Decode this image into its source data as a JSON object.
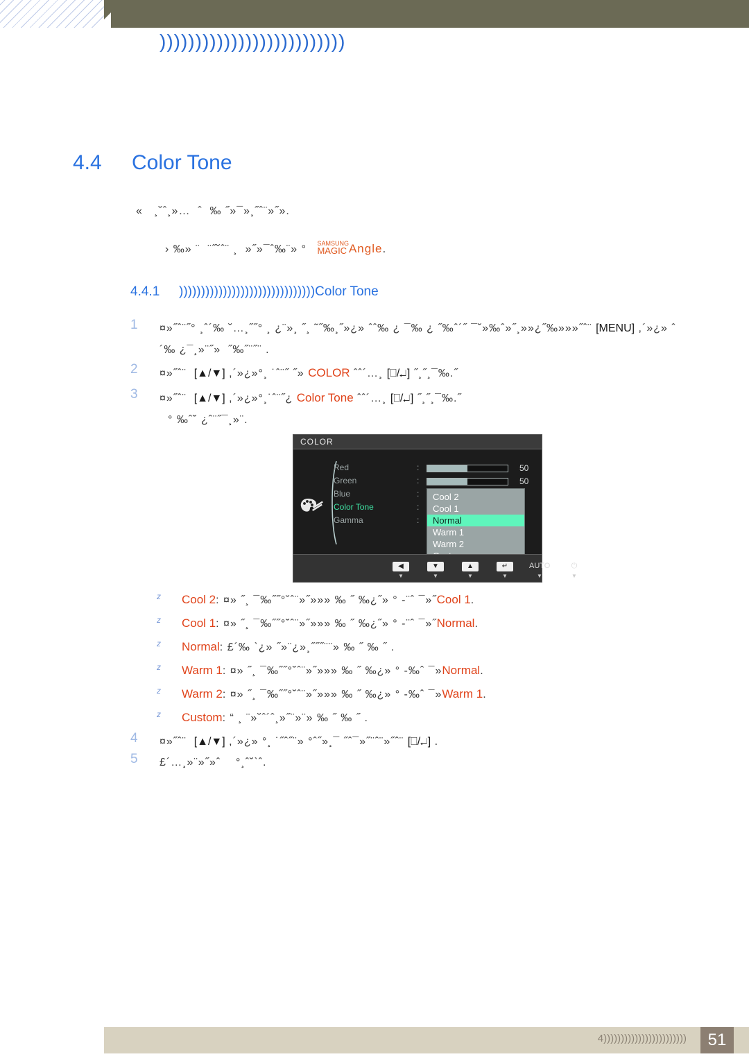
{
  "header": {
    "chapter_title": "))))))))))))))))))))))))))"
  },
  "section": {
    "number": "4.4",
    "title": "Color Tone"
  },
  "intro": {
    "line1": "«   ¸˘ˆ¸»…  ˆ  ‰ ˝»¯»¸˝ˆ¨»˝».",
    "line2": "› ‰» ¨  ¨˝˘ˆ¨ ¸  »˝»¯ˆ‰¨» °",
    "magic_top": "SAMSUNG",
    "magic_bottom": "MAGIC",
    "magic_word": "Angle",
    "magic_dot": "."
  },
  "subsection": {
    "number": "4.4.1",
    "boxes": ")))))))))))))))))))))))))))))))",
    "title": "Color Tone"
  },
  "steps": [
    {
      "number": "1",
      "segments": [
        {
          "type": "text",
          "value": "¤»˝ˆ¨˝° ¸ˆ´‰ ˘…¸˝˝° ¸ ¿¨»¸ ˝¸ ˜˝‰¸˝»¿» ˆˆ‰ ¿ ¯‰ ¿ ˝‰ˆ´˝"
        },
        {
          "type": "text",
          "value": "¯˘»‰ˆ»˝¸»»¿˝‰»»»˝ˆ¨"
        },
        {
          "type": "key",
          "value": "[MENU]"
        },
        {
          "type": "text",
          "value": ",´»¿» ˆ´‰ ¿¯¸»¨˝»  ˝‰˝¨˝¨ ."
        }
      ]
    },
    {
      "number": "2",
      "segments": [
        {
          "type": "text",
          "value": "¤»˝ˆ¨ "
        },
        {
          "type": "key",
          "value": "[▲/▼]"
        },
        {
          "type": "text",
          "value": ",´»¿»°¸ ˙ˆ¨˝ ˝»"
        },
        {
          "type": "kw",
          "value": "COLOR"
        },
        {
          "type": "text",
          "value": "ˆˆ´…¸"
        },
        {
          "type": "key",
          "value": "[⎕/↵]"
        },
        {
          "type": "text",
          "value": "˝¸˝¸¯‰.˝"
        }
      ]
    },
    {
      "number": "3",
      "segments": [
        {
          "type": "text",
          "value": "¤»˝ˆ¨ "
        },
        {
          "type": "key",
          "value": "[▲/▼]"
        },
        {
          "type": "text",
          "value": ",´»¿»°¸˙ˆ¨˝¿"
        },
        {
          "type": "kw",
          "value": "Color Tone"
        },
        {
          "type": "text",
          "value": "ˆˆ´…¸"
        },
        {
          "type": "key",
          "value": "[⎕/↵]"
        },
        {
          "type": "text",
          "value": "˝¸˝¸¯‰.˝"
        }
      ],
      "line2": "° ‰ˆ˘ ¿ˆ¨˝¯¸»¨."
    }
  ],
  "osd": {
    "title": "COLOR",
    "icon": "palette-icon",
    "rows": [
      {
        "label": "Red",
        "colon": ":",
        "kind": "slider",
        "value": "50",
        "percent": 50
      },
      {
        "label": "Green",
        "colon": ":",
        "kind": "slider",
        "value": "50",
        "percent": 50
      },
      {
        "label": "Blue",
        "colon": ":",
        "kind": "none"
      },
      {
        "label": "Color Tone",
        "colon": ":",
        "kind": "none",
        "active": true
      },
      {
        "label": "Gamma",
        "colon": ":",
        "kind": "none"
      }
    ],
    "dropdown": {
      "items": [
        "Cool 2",
        "Cool 1",
        "Normal",
        "Warm 1",
        "Warm 2",
        "Custom"
      ],
      "selected": "Normal"
    },
    "footer_keys": [
      {
        "name": "left-arrow-key",
        "glyph": "◀",
        "style": "box",
        "mark": "▼"
      },
      {
        "name": "down-arrow-key",
        "glyph": "▼",
        "style": "box",
        "mark": "▼"
      },
      {
        "name": "up-arrow-key",
        "glyph": "▲",
        "style": "box",
        "mark": "▼"
      },
      {
        "name": "enter-key",
        "glyph": "↵",
        "style": "box",
        "mark": "▼"
      },
      {
        "name": "auto-key",
        "glyph": "AUTO",
        "style": "text",
        "mark": "▼"
      },
      {
        "name": "power-key",
        "glyph": "⏻",
        "style": "text",
        "mark": "▼"
      }
    ],
    "colors": {
      "background": "#1c1c1c",
      "titlebar": "#3b3b3b",
      "active_label": "#3fe3a4",
      "dropdown_bg": "#9aa5a5",
      "selected_bg": "#5ff5bc",
      "slider_fill": "#a6bbbb"
    }
  },
  "bullets": [
    {
      "marker": "z",
      "label": "Cool 2",
      "colon": ":",
      "text": "¤» ˝¸ ¯‰˝˝°˘ˆ¨»˝»»» ‰ ˝ ‰¿˝» ° -¨ˆ ¯»˝",
      "ref": "Cool 1",
      "period": "."
    },
    {
      "marker": "z",
      "label": "Cool 1",
      "colon": ":",
      "text": "¤» ˝¸ ¯‰˝˝°˘ˆ¨»˝»»» ‰ ˝ ‰¿˝» ° -¨ˆ ¯»˝",
      "ref": "Normal",
      "period": "."
    },
    {
      "marker": "z",
      "label": "Normal",
      "colon": ":",
      "text": "£´‰ ˋ¿» ˝»¨¿»¸˝˝˝¨¨» ‰ ˝ ‰ ˝ .",
      "ref": "",
      "period": ""
    },
    {
      "marker": "z",
      "label": "Warm 1",
      "colon": ":",
      "text": "¤» ˝¸ ¯‰˝˝°˘ˆ¨»˝»»» ‰ ˝ ‰¿» ° -‰ˆ ¯»",
      "ref": "Normal",
      "period": "."
    },
    {
      "marker": "z",
      "label": "Warm 2",
      "colon": ":",
      "text": "¤» ˝¸ ¯‰˝˝°˘ˆ¨»˝»»» ‰ ˝ ‰¿» ° -‰ˆ ¯»",
      "ref": "Warm 1",
      "period": "."
    },
    {
      "marker": "z",
      "label": "Custom",
      "colon": ":",
      "text": "“ ¸ ¨»˘ˆ´ˆ¸»˝¨»¨» ‰ ˝ ‰ ˝ .",
      "ref": "",
      "period": ""
    }
  ],
  "steps_tail": [
    {
      "number": "4",
      "segments": [
        {
          "type": "text",
          "value": "¤»˝ˆ¨ "
        },
        {
          "type": "key",
          "value": "[▲/▼]"
        },
        {
          "type": "text",
          "value": ",´»¿» °¸ ˙˝ˆ˝¨» °ˆ˝»¸¯ ˝ˆ¯»˝¨ˆ¨»˝ˆ¨"
        },
        {
          "type": "key",
          "value": "[⎕/↵]"
        },
        {
          "type": "text",
          "value": "."
        }
      ]
    },
    {
      "number": "5",
      "segments": [
        {
          "type": "text",
          "value": "£´…¸»¨»˝»ˆ    °¸ˆ˘ˋˆ."
        }
      ]
    }
  ],
  "footer": {
    "chapter": "4",
    "boxes": "))))))))))))))))))))))))",
    "page": "51"
  }
}
